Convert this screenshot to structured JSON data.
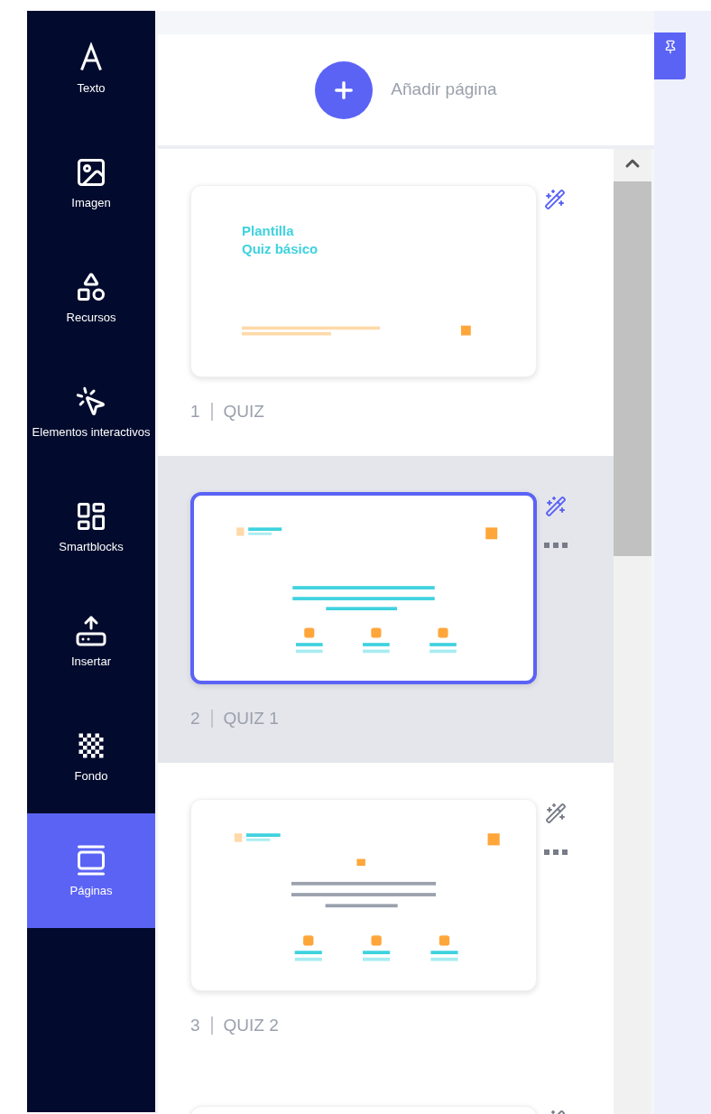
{
  "sidebar": {
    "items": [
      {
        "label": "Texto",
        "kind": "text",
        "selected": false
      },
      {
        "label": "Imagen",
        "kind": "image",
        "selected": false
      },
      {
        "label": "Recursos",
        "kind": "shapes",
        "selected": false
      },
      {
        "label": "Elementos interactivos",
        "kind": "interactive",
        "selected": false
      },
      {
        "label": "Smartblocks",
        "kind": "blocks",
        "selected": false
      },
      {
        "label": "Insertar",
        "kind": "insert",
        "selected": false
      },
      {
        "label": "Fondo",
        "kind": "background",
        "selected": false
      },
      {
        "label": "Páginas",
        "kind": "pages",
        "selected": true
      }
    ]
  },
  "add_page": {
    "label": "Añadir página"
  },
  "pages": [
    {
      "kind": "cover",
      "number": "1",
      "title": "QUIZ",
      "selected": false,
      "menu": false,
      "wand_highlighted": true,
      "heading": [
        "Plantilla",
        "Quiz básico"
      ]
    },
    {
      "kind": "quiz",
      "number": "2",
      "title": "QUIZ 1",
      "selected": true,
      "menu": true,
      "wand_highlighted": true
    },
    {
      "kind": "quiz_image",
      "number": "3",
      "title": "QUIZ 2",
      "selected": false,
      "menu": true,
      "wand_highlighted": false
    },
    {
      "kind": "blank",
      "selected": false,
      "menu": false,
      "wand_highlighted": false
    }
  ]
}
